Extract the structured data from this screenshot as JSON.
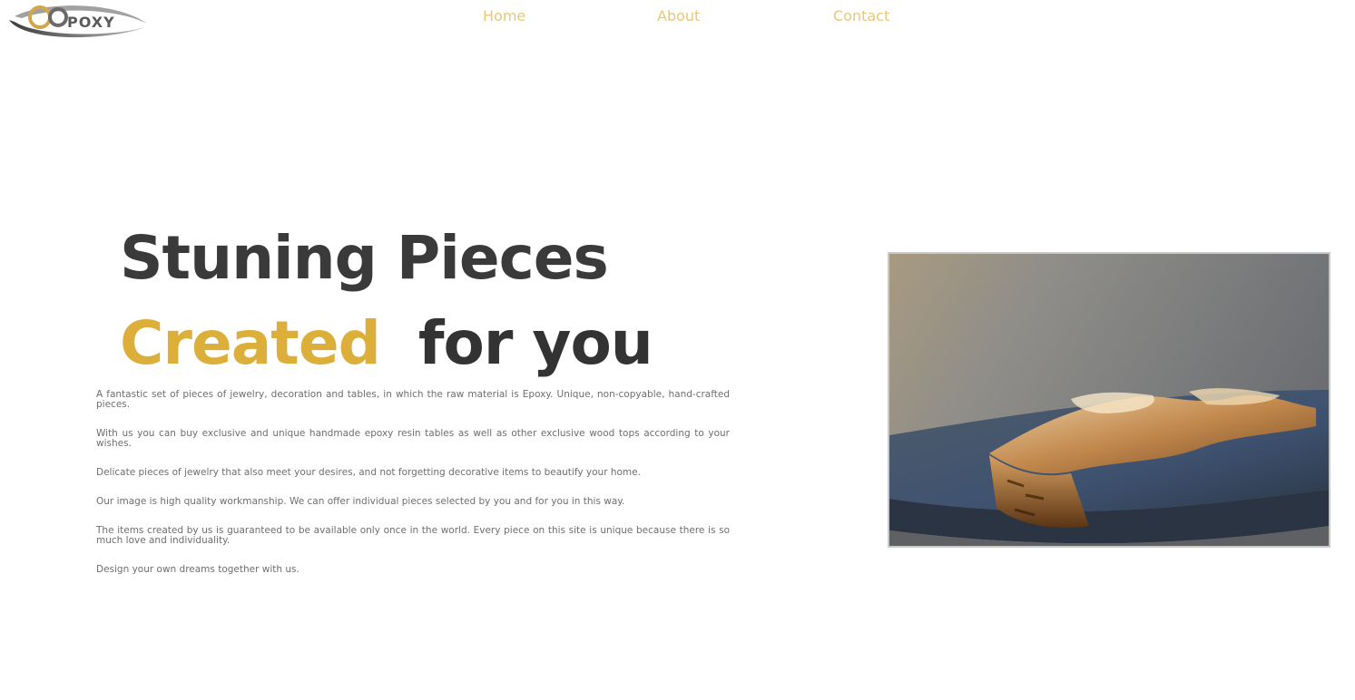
{
  "header": {
    "logo_text": "OBPOXY",
    "nav": {
      "home": "Home",
      "about": "About",
      "contact": "Contact"
    }
  },
  "hero": {
    "headline_line1": "Stuning Pieces",
    "headline_line2_accent": "Created",
    "headline_line2_rest": "for you",
    "paragraphs": [
      "A fantastic set of pieces of jewelry, decoration and tables, in which the raw material is Epoxy. Unique, non-copyable, hand-crafted pieces.",
      "With us you can buy exclusive and unique handmade epoxy resin tables as well as other exclusive wood tops according to your wishes.",
      "Delicate pieces of jewelry that also meet your desires, and not forgetting decorative items to beautify your home.",
      "Our image is high quality workmanship. We can offer individual pieces selected by you and for you in this way.",
      "The items created by us is guaranteed to be available only once in the world. Every piece on this site is unique because there is so much love and individuality.",
      "Design your own dreams together with us."
    ]
  },
  "colors": {
    "accent": "#dcae3a",
    "nav_link": "#e8c878",
    "heading": "#333333",
    "body_text": "#6e6e6e"
  },
  "icons": {
    "logo": "brand-logo-icon",
    "photo": "epoxy-table-photo"
  }
}
